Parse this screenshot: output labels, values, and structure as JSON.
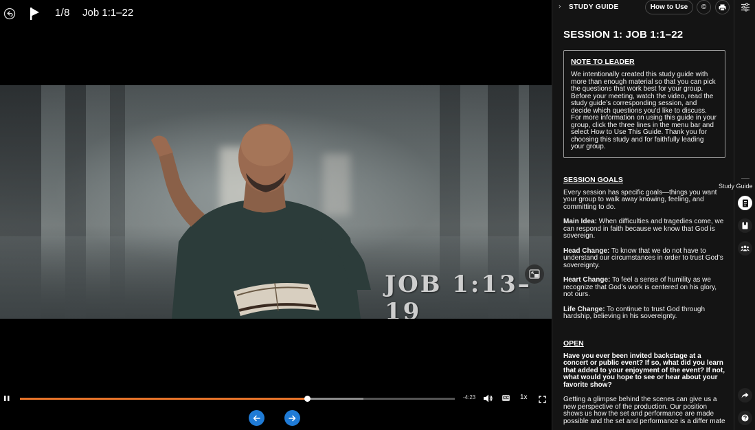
{
  "topbar": {
    "back_icon": "undo-icon",
    "logo_icon": "flag-logo-icon",
    "counter": "1/8",
    "title": "Job 1:1–22"
  },
  "video": {
    "overlay_text": "JOB 1:13–19",
    "pip_icon": "picture-in-picture-icon"
  },
  "controls": {
    "play_state": "playing",
    "progress": 0.66,
    "buffered": 0.79,
    "time_remaining": "-4:23",
    "speed": "1x",
    "cc_label": "CC",
    "accent_color": "#e8742a"
  },
  "nav": {
    "prev_icon": "arrow-left-icon",
    "next_icon": "arrow-right-icon",
    "button_color": "#1f7bd6"
  },
  "panel": {
    "chevron": "›",
    "title": "STUDY GUIDE",
    "how_to_use": "How to Use",
    "copyright_symbol": "©",
    "session_heading": "SESSION 1: JOB 1:1–22",
    "note_to_leader": {
      "title": "NOTE TO LEADER",
      "text": "We intentionally created this study guide with more than enough material so that you can pick the questions that work best for your group. Before your meeting, watch the video, read the study guide’s corresponding session, and decide which questions you’d like to discuss. For more information on using this guide in your group, click the three lines in the menu bar and select How to Use This Guide. Thank you for choosing this study and for faithfully leading your group."
    },
    "session_goals": {
      "title": "SESSION GOALS",
      "intro": "Every session has specific goals—things you want your group to walk away knowing, feeling, and committing to do.",
      "goals": [
        {
          "label": "Main Idea:",
          "text": " When difficulties and tragedies come, we can respond in faith because we know that God is sovereign."
        },
        {
          "label": "Head Change:",
          "text": " To know that we do not have to understand our circumstances in order to trust God’s sovereignty."
        },
        {
          "label": "Heart Change:",
          "text": " To feel a sense of humility as we recognize that God’s work is centered on his glory, not ours."
        },
        {
          "label": "Life Change:",
          "text": " To continue to trust God through hardship, believing in his sovereignty."
        }
      ]
    },
    "open": {
      "title": "OPEN",
      "question": "Have you ever been invited backstage at a concert or public event? If so, what did you learn that added to your enjoyment of the event? If not, what would you hope to see or hear about your favorite show?",
      "text": "Getting a glimpse behind the scenes can give us a new perspective of the production. Our position shows us how the set and performance are made possible and the set and performance is a differ mate"
    }
  },
  "rail": {
    "tooltip": "Study Guide",
    "settings_icon": "sliders-icon",
    "items": [
      "study-guide-icon",
      "bookmark-icon",
      "group-icon",
      "share-icon",
      "help-icon"
    ]
  }
}
